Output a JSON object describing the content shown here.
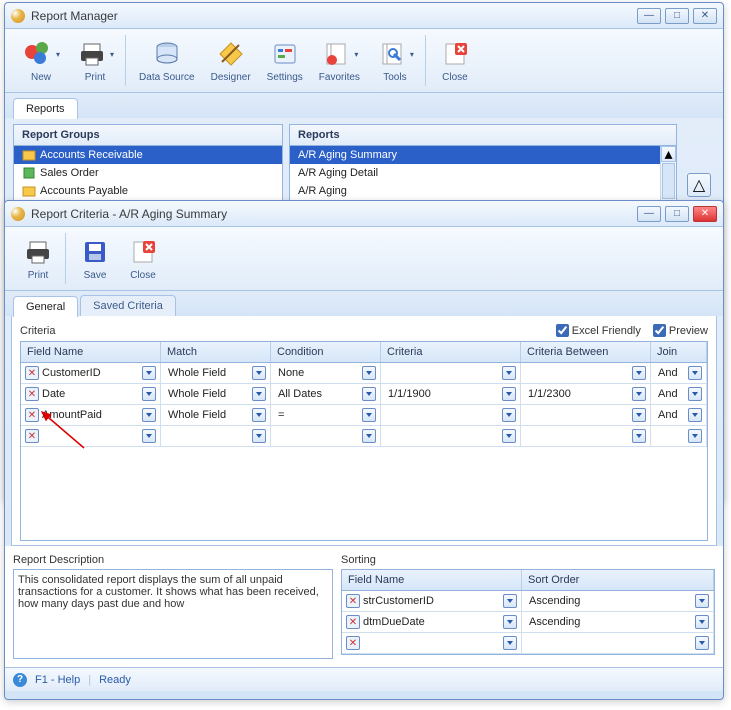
{
  "mgr": {
    "title": "Report Manager",
    "toolbar": {
      "new": "New",
      "print": "Print",
      "datasource": "Data Source",
      "designer": "Designer",
      "settings": "Settings",
      "favorites": "Favorites",
      "tools": "Tools",
      "close": "Close"
    },
    "tab": "Reports",
    "groups_head": "Report Groups",
    "reports_head": "Reports",
    "groups": [
      {
        "label": "Accounts Receivable",
        "sel": true
      },
      {
        "label": "Sales Order",
        "sel": false
      },
      {
        "label": "Accounts Payable",
        "sel": false
      }
    ],
    "reports": [
      {
        "label": "A/R Aging Summary",
        "sel": true
      },
      {
        "label": "A/R Aging Detail",
        "sel": false
      },
      {
        "label": "A/R Aging",
        "sel": false
      }
    ]
  },
  "crit": {
    "title": "Report Criteria - A/R Aging Summary",
    "toolbar": {
      "print": "Print",
      "save": "Save",
      "close": "Close"
    },
    "tabs": {
      "general": "General",
      "saved": "Saved Criteria"
    },
    "criteria_label": "Criteria",
    "excel_friendly": "Excel Friendly",
    "preview": "Preview",
    "cols": {
      "field": "Field Name",
      "match": "Match",
      "cond": "Condition",
      "crit": "Criteria",
      "between": "Criteria Between",
      "join": "Join"
    },
    "rows": [
      {
        "field": "CustomerID",
        "match": "Whole Field",
        "cond": "None",
        "crit": "",
        "between": "",
        "join": "And"
      },
      {
        "field": "Date",
        "match": "Whole Field",
        "cond": "All Dates",
        "crit": "1/1/1900",
        "between": "1/1/2300",
        "join": "And"
      },
      {
        "field": " AmountPaid",
        "match": "Whole Field",
        "cond": "=",
        "crit": "",
        "between": "",
        "join": "And"
      },
      {
        "field": "",
        "match": "",
        "cond": "",
        "crit": "",
        "between": "",
        "join": ""
      }
    ],
    "desc_label": "Report Description",
    "desc": "This consolidated report displays the sum of all unpaid transactions for a customer.  It shows what has been received, how many days past due and how",
    "sort_label": "Sorting",
    "sort_cols": {
      "field": "Field Name",
      "order": "Sort Order"
    },
    "sort_rows": [
      {
        "field": "strCustomerID",
        "order": "Ascending"
      },
      {
        "field": "dtmDueDate",
        "order": "Ascending"
      },
      {
        "field": "",
        "order": ""
      }
    ],
    "status": {
      "help": "F1 - Help",
      "ready": "Ready"
    }
  }
}
